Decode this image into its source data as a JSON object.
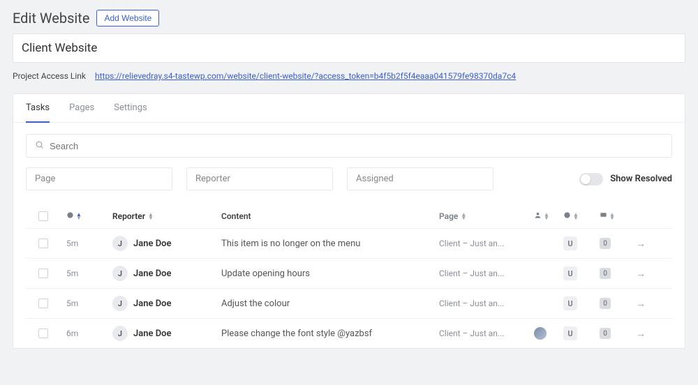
{
  "header": {
    "title": "Edit Website",
    "add_button": "Add Website"
  },
  "website_name": "Client Website",
  "access_link": {
    "label": "Project Access Link",
    "url": "https://relievedray.s4-tastewp.com/website/client-website/?access_token=b4f5b2f5f4eaaa041579fe98370da7c4"
  },
  "tabs": [
    {
      "label": "Tasks",
      "active": true
    },
    {
      "label": "Pages",
      "active": false
    },
    {
      "label": "Settings",
      "active": false
    }
  ],
  "search": {
    "placeholder": "Search"
  },
  "filters": {
    "page": "Page",
    "reporter": "Reporter",
    "assigned": "Assigned"
  },
  "show_resolved": {
    "label": "Show Resolved",
    "value": false
  },
  "columns": {
    "reporter": "Reporter",
    "content": "Content",
    "page": "Page"
  },
  "rows": [
    {
      "time": "5m",
      "reporter_initial": "J",
      "reporter_name": "Jane Doe",
      "content": "This item is no longer on the menu",
      "page": "Client – Just an...",
      "assigned_avatar": false,
      "status": "U",
      "count": "0"
    },
    {
      "time": "5m",
      "reporter_initial": "J",
      "reporter_name": "Jane Doe",
      "content": "Update opening hours",
      "page": "Client – Just an...",
      "assigned_avatar": false,
      "status": "U",
      "count": "0"
    },
    {
      "time": "5m",
      "reporter_initial": "J",
      "reporter_name": "Jane Doe",
      "content": "Adjust the colour",
      "page": "Client – Just an...",
      "assigned_avatar": false,
      "status": "U",
      "count": "0"
    },
    {
      "time": "6m",
      "reporter_initial": "J",
      "reporter_name": "Jane Doe",
      "content": "Please change the font style @yazbsf",
      "page": "Client – Just an...",
      "assigned_avatar": true,
      "status": "U",
      "count": "0"
    }
  ]
}
